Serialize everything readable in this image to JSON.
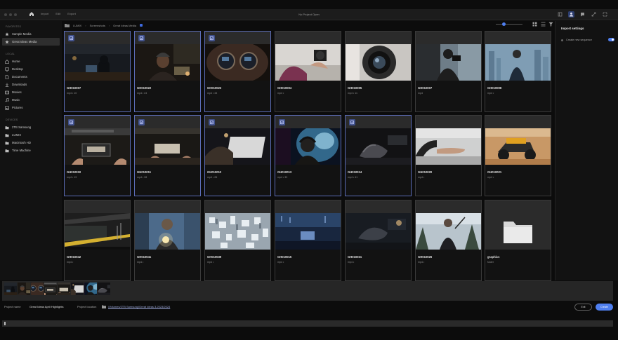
{
  "window": {
    "title": "No Project Open",
    "tabs": [
      {
        "label": "Import",
        "active": true
      },
      {
        "label": "Edit",
        "active": false
      },
      {
        "label": "Export",
        "active": false
      }
    ],
    "toolbar_icons": [
      "workspaces-icon",
      "account-icon",
      "notifications-icon",
      "maximize-icon",
      "fullscreen-icon"
    ]
  },
  "sidebar": {
    "sections": [
      {
        "heading": "FAVORITES",
        "items": [
          {
            "label": "Sample Media",
            "icon": "star-icon",
            "active": false
          },
          {
            "label": "Great Ideas Media",
            "icon": "star-icon",
            "active": true
          }
        ]
      },
      {
        "heading": "LOCAL",
        "items": [
          {
            "label": "Home",
            "icon": "home-icon",
            "active": false
          },
          {
            "label": "Desktop",
            "icon": "desktop-icon",
            "active": false
          },
          {
            "label": "Documents",
            "icon": "document-icon",
            "active": false
          },
          {
            "label": "Downloads",
            "icon": "download-icon",
            "active": false
          },
          {
            "label": "Movies",
            "icon": "film-icon",
            "active": false
          },
          {
            "label": "Music",
            "icon": "music-icon",
            "active": false
          },
          {
            "label": "Pictures",
            "icon": "image-icon",
            "active": false
          }
        ]
      },
      {
        "heading": "DEVICES",
        "items": [
          {
            "label": "2TB Samsung",
            "icon": "drive-icon",
            "active": false
          },
          {
            "label": "LUMIX",
            "icon": "drive-icon",
            "active": false
          },
          {
            "label": "Macintosh HD",
            "icon": "drive-icon",
            "active": false
          },
          {
            "label": "Time Machine",
            "icon": "drive-icon",
            "active": false
          }
        ]
      }
    ]
  },
  "breadcrumb": [
    "LUMIX",
    "Screenshots",
    "Great Ideas Media"
  ],
  "grid": {
    "items": [
      {
        "name": "GH010007",
        "meta": "mp4 • 10",
        "selected": true,
        "scene": "man-laptop-dark"
      },
      {
        "name": "GH010022",
        "meta": "mp4 • 24",
        "selected": true,
        "scene": "man-beanie-laptop"
      },
      {
        "name": "GH010023",
        "meta": "mp4 • 33",
        "selected": true,
        "scene": "glasses-closeup"
      },
      {
        "name": "GH010004",
        "meta": "mp4 •",
        "selected": false,
        "scene": "camera-hands"
      },
      {
        "name": "GH010005",
        "meta": "mp4 • 11",
        "selected": false,
        "scene": "lens-closeup"
      },
      {
        "name": "GH010007",
        "meta": "mp4",
        "selected": false,
        "scene": "man-window-camera"
      },
      {
        "name": "GH010008",
        "meta": "mp4 •",
        "selected": false,
        "scene": "man-city-view"
      },
      {
        "name": "GH010010",
        "meta": "mp4 • 19",
        "selected": true,
        "scene": "hands-tablet"
      },
      {
        "name": "GH010011",
        "meta": "mp4 • 28",
        "selected": true,
        "scene": "hands-device"
      },
      {
        "name": "GH010012",
        "meta": "mp4 • 26",
        "selected": true,
        "scene": "hand-trackpad"
      },
      {
        "name": "GH010013",
        "meta": "mp4 • 33",
        "selected": true,
        "scene": "headphones-man"
      },
      {
        "name": "GH010014",
        "meta": "mp4 • 41",
        "selected": true,
        "scene": "hand-mouse"
      },
      {
        "name": "GH010020",
        "meta": "mp4 •",
        "selected": false,
        "scene": "steering-wheel"
      },
      {
        "name": "GH010021",
        "meta": "mp4 •",
        "selected": false,
        "scene": "desert-buggy"
      },
      {
        "name": "GH010042",
        "meta": "mp4 •",
        "selected": false,
        "scene": "train-platform"
      },
      {
        "name": "GH010041",
        "meta": "mp4 •",
        "selected": false,
        "scene": "man-flashlight"
      },
      {
        "name": "GH010039",
        "meta": "mp4 •",
        "selected": false,
        "scene": "city-aerial"
      },
      {
        "name": "GH010015",
        "meta": "mp4 •",
        "selected": false,
        "scene": "night-desk"
      },
      {
        "name": "GH010031",
        "meta": "mp4 •",
        "selected": false,
        "scene": "desk-mouse"
      },
      {
        "name": "GH010026",
        "meta": "mp4 •",
        "selected": false,
        "scene": "man-snow-selfie"
      },
      {
        "name": "graphics",
        "meta": "folder",
        "selected": false,
        "scene": "folder"
      }
    ]
  },
  "import_settings": {
    "title": "Import settings",
    "create_new_sequence_label": "Create new sequence",
    "create_new_sequence_on": true
  },
  "footer": {
    "project_name_label": "Project name",
    "project_name_value": "Great Ideas April Highlights",
    "project_location_label": "Project location",
    "project_location_value": "/Volumes/2TB Samsung/Great Ideas 3.2023/2024",
    "exit_label": "Exit",
    "create_label": "Create"
  },
  "selection_strip": {
    "scenes": [
      "man-laptop-dark",
      "man-beanie-laptop",
      "glasses-closeup",
      "hands-tablet",
      "hands-device",
      "hand-trackpad",
      "headphones-man",
      "hand-mouse"
    ]
  },
  "colors": {
    "accent": "#4f7ff0",
    "selected_border": "#5b6cb6",
    "badge": "#3f4f8a"
  }
}
